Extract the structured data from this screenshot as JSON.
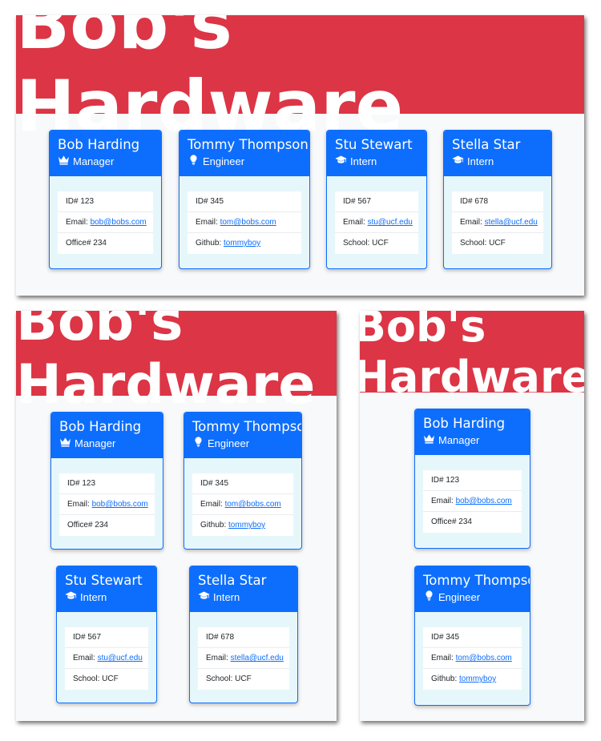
{
  "app_title": "Bob's Hardware",
  "icons": {
    "Manager": "crown-icon",
    "Engineer": "lightbulb-icon",
    "Intern": "graduation-cap-icon"
  },
  "colors": {
    "jumbotron": "#dc3545",
    "card_header": "#0d6efd",
    "card_body": "#e6f7fb",
    "page_background": "#f8f9fa",
    "link": "#0d6efd"
  },
  "employees": [
    {
      "name": "Bob Harding",
      "role": "Manager",
      "id_text": "ID# 123",
      "line2_label": "Email: ",
      "line2_link": "bob@bobs.com",
      "line3_label": "Office# 234",
      "line3_link": ""
    },
    {
      "name": "Tommy Thompson",
      "role": "Engineer",
      "id_text": "ID# 345",
      "line2_label": "Email: ",
      "line2_link": "tom@bobs.com",
      "line3_label": "Github: ",
      "line3_link": "tommyboy"
    },
    {
      "name": "Stu Stewart",
      "role": "Intern",
      "id_text": "ID# 567",
      "line2_label": "Email: ",
      "line2_link": "stu@ucf.edu",
      "line3_label": "School: UCF",
      "line3_link": ""
    },
    {
      "name": "Stella Star",
      "role": "Intern",
      "id_text": "ID# 678",
      "line2_label": "Email: ",
      "line2_link": "stella@ucf.edu",
      "line3_label": "School: UCF",
      "line3_link": ""
    }
  ]
}
